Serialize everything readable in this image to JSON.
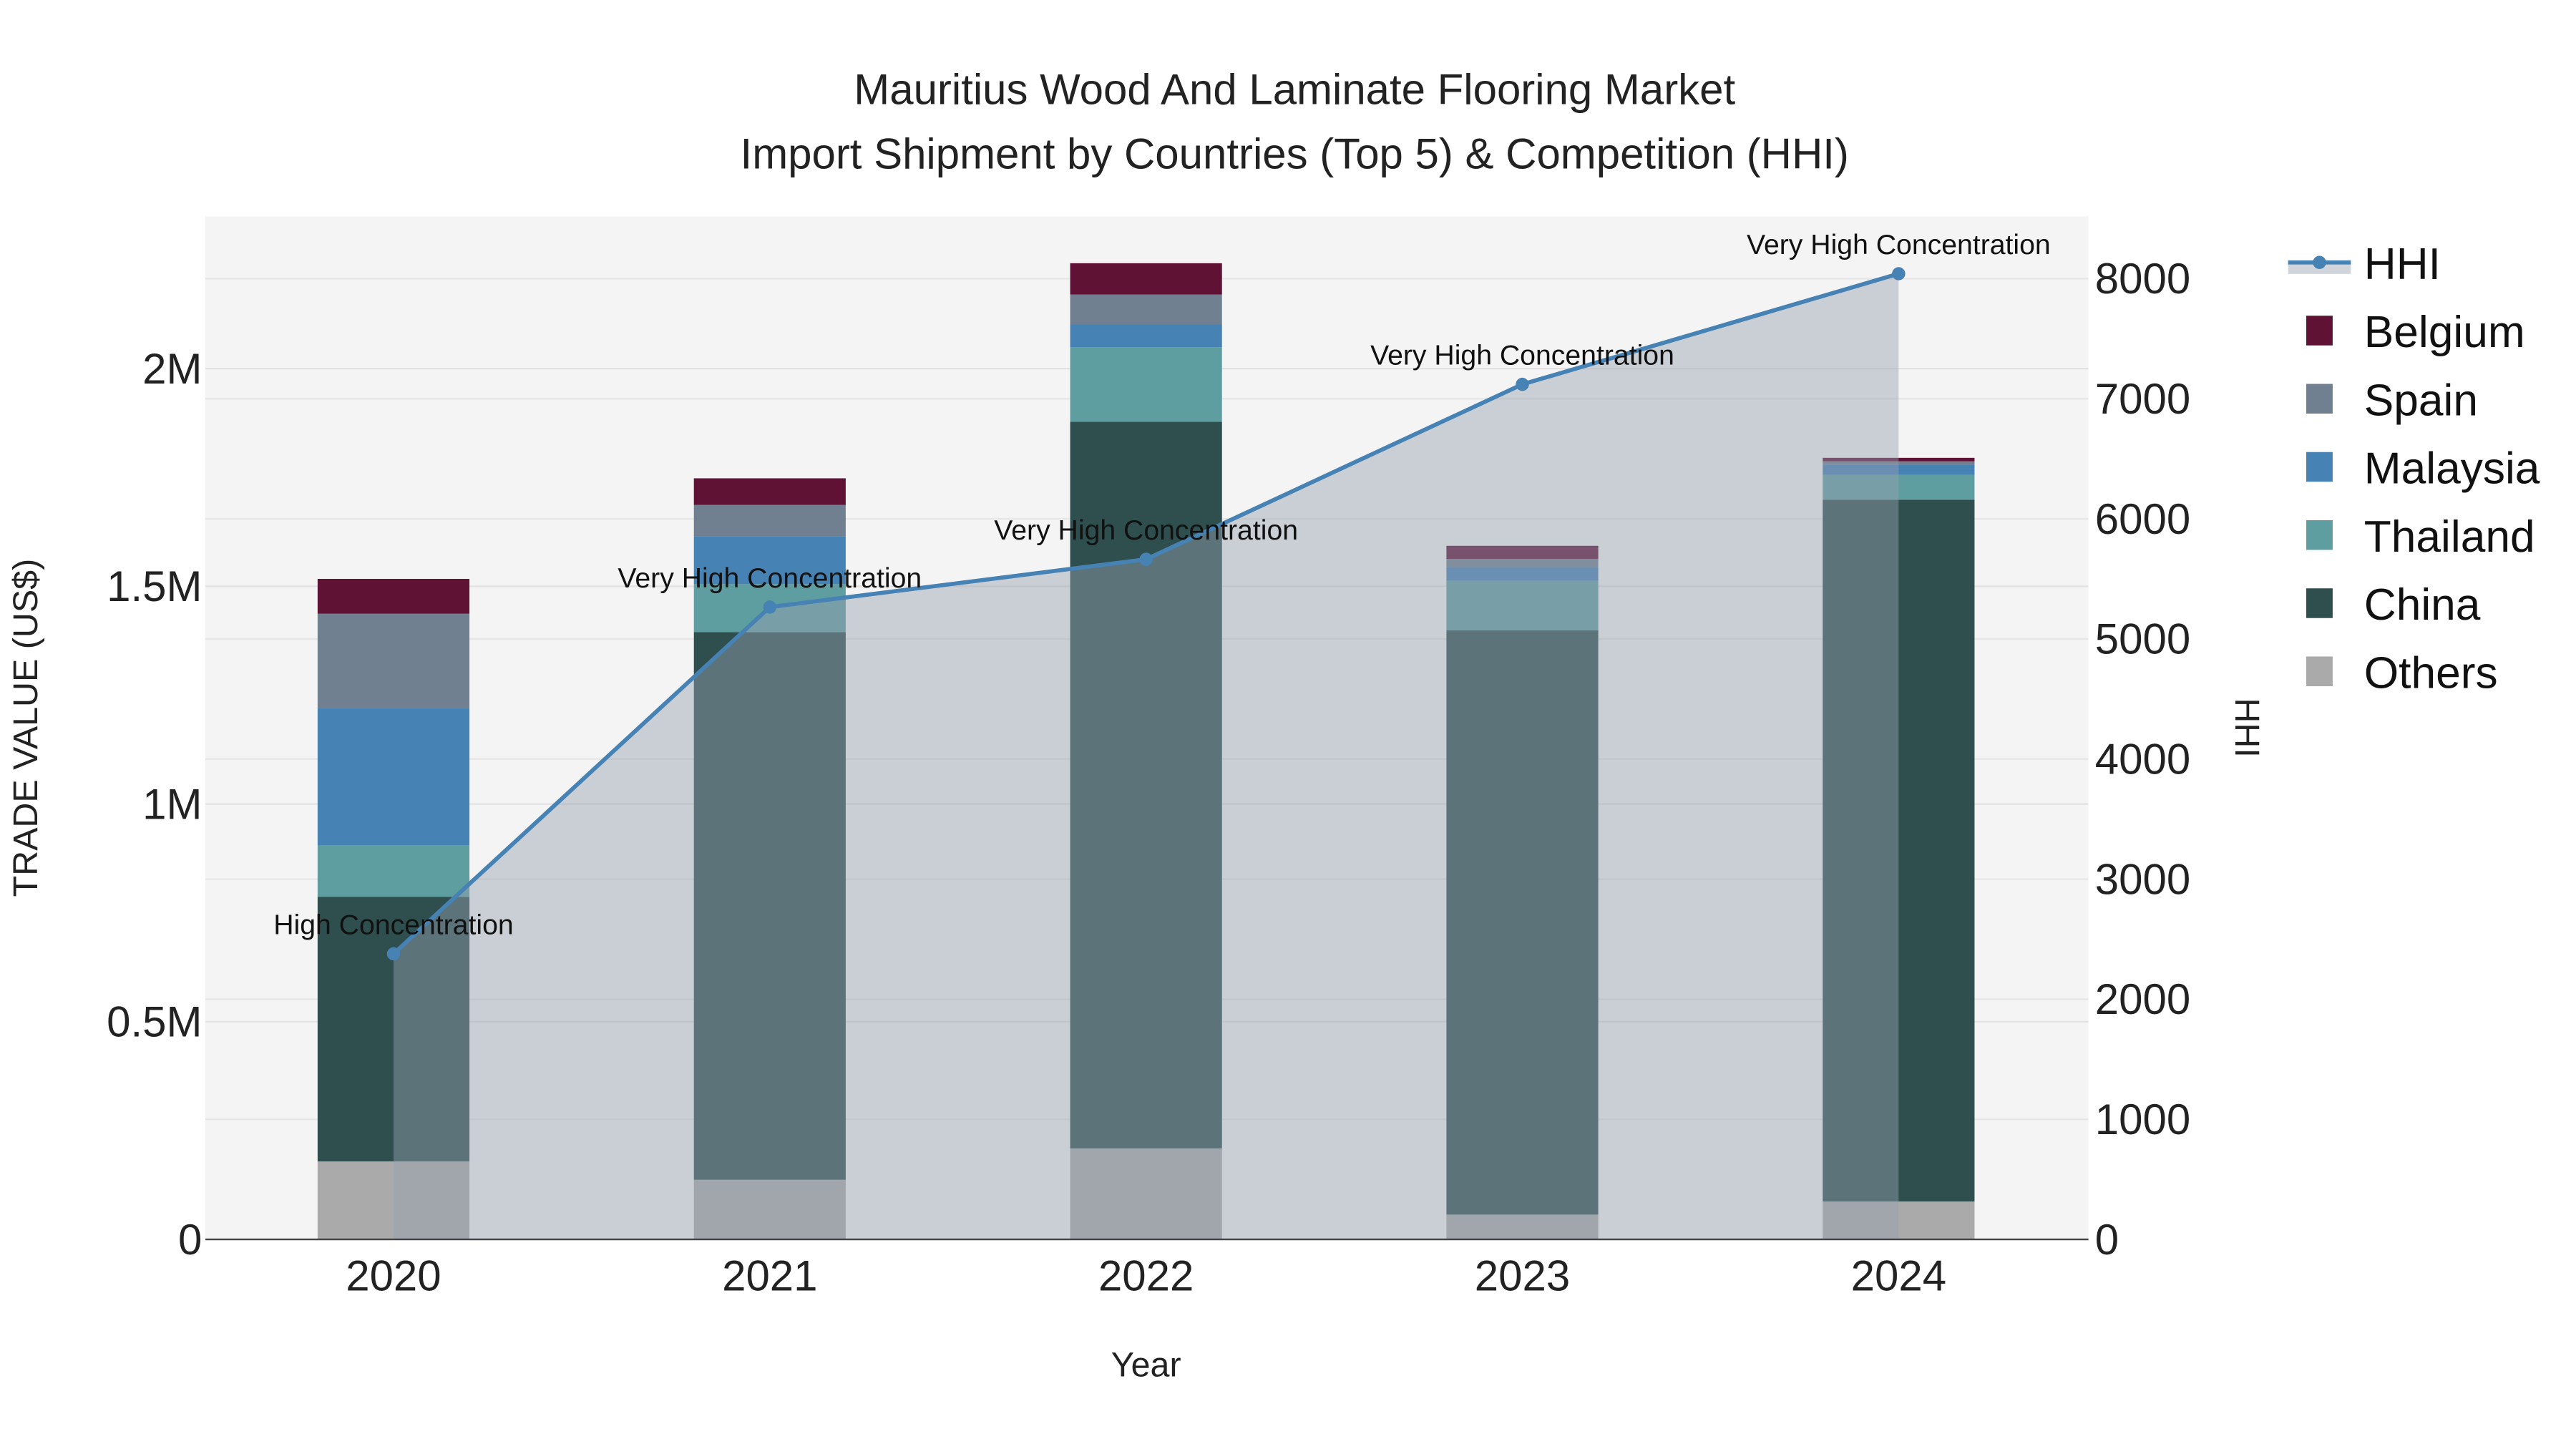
{
  "chart_data": {
    "type": "bar",
    "title_line1": "Mauritius Wood And Laminate Flooring Market",
    "title_line2": "Import Shipment by Countries (Top 5) & Competition (HHI)",
    "xlabel": "Year",
    "ylabel": "TRADE VALUE (US$)",
    "y2label": "HHI",
    "categories": [
      "2020",
      "2021",
      "2022",
      "2023",
      "2024"
    ],
    "ylim": [
      0,
      2350000
    ],
    "y2lim": [
      0,
      8520
    ],
    "yticks": [
      {
        "v": 0,
        "label": "0"
      },
      {
        "v": 500000,
        "label": "0.5M"
      },
      {
        "v": 1000000,
        "label": "1M"
      },
      {
        "v": 1500000,
        "label": "1.5M"
      },
      {
        "v": 2000000,
        "label": "2M"
      }
    ],
    "y2ticks": [
      0,
      1000,
      2000,
      3000,
      4000,
      5000,
      6000,
      7000,
      8000
    ],
    "grid": true,
    "legend_position": "right",
    "series": [
      {
        "name": "Others",
        "color": "#aaaaaa",
        "values": [
          179000,
          137000,
          209000,
          57000,
          87000
        ]
      },
      {
        "name": "China",
        "color": "#2f4f4f",
        "values": [
          608000,
          1258000,
          1669000,
          1342000,
          1612000
        ]
      },
      {
        "name": "Thailand",
        "color": "#5f9ea0",
        "values": [
          118000,
          110000,
          171000,
          114000,
          57000
        ]
      },
      {
        "name": "Malaysia",
        "color": "#4682b4",
        "values": [
          315000,
          110000,
          53000,
          31000,
          23000
        ]
      },
      {
        "name": "Spain",
        "color": "#708090",
        "values": [
          217000,
          72000,
          68000,
          19000,
          8000
        ]
      },
      {
        "name": "Belgium",
        "color": "#601235",
        "values": [
          80000,
          61000,
          72000,
          30000,
          8000
        ]
      }
    ],
    "hhi": {
      "name": "HHI",
      "color": "#4682b4",
      "values": [
        2378,
        5265,
        5663,
        7120,
        8041
      ],
      "annotations": [
        "High Concentration",
        "Very High Concentration",
        "Very High Concentration",
        "Very High Concentration",
        "Very High Concentration"
      ]
    },
    "legend_order": [
      "HHI",
      "Belgium",
      "Spain",
      "Malaysia",
      "Thailand",
      "China",
      "Others"
    ]
  }
}
